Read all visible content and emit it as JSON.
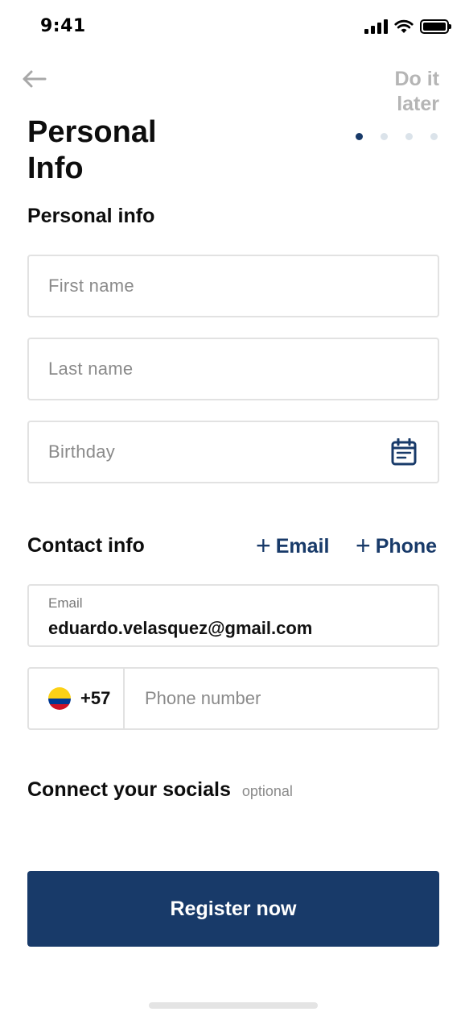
{
  "status_bar": {
    "time": "9:41"
  },
  "header": {
    "skip_label_line1": "Do it",
    "skip_label_line2": "later",
    "title_line1": "Personal",
    "title_line2": "Info",
    "steps_total": 4,
    "step_current": 1
  },
  "personal_section": {
    "title": "Personal info",
    "first_name_placeholder": "First name",
    "last_name_placeholder": "Last name",
    "birthday_placeholder": "Birthday"
  },
  "contact_section": {
    "title": "Contact info",
    "add_email_label": "Email",
    "add_phone_label": "Phone",
    "email_label": "Email",
    "email_value": "eduardo.velasquez@gmail.com",
    "country_code": "+57",
    "phone_placeholder": "Phone number"
  },
  "socials_section": {
    "title": "Connect your socials",
    "optional_label": "optional"
  },
  "register_button": {
    "label": "Register now"
  },
  "colors": {
    "primary": "#183a69",
    "muted_text": "#8a8a8a",
    "border": "#e2e2e2",
    "flag_yellow": "#fcd116",
    "flag_blue": "#003893",
    "flag_red": "#ce1126"
  }
}
